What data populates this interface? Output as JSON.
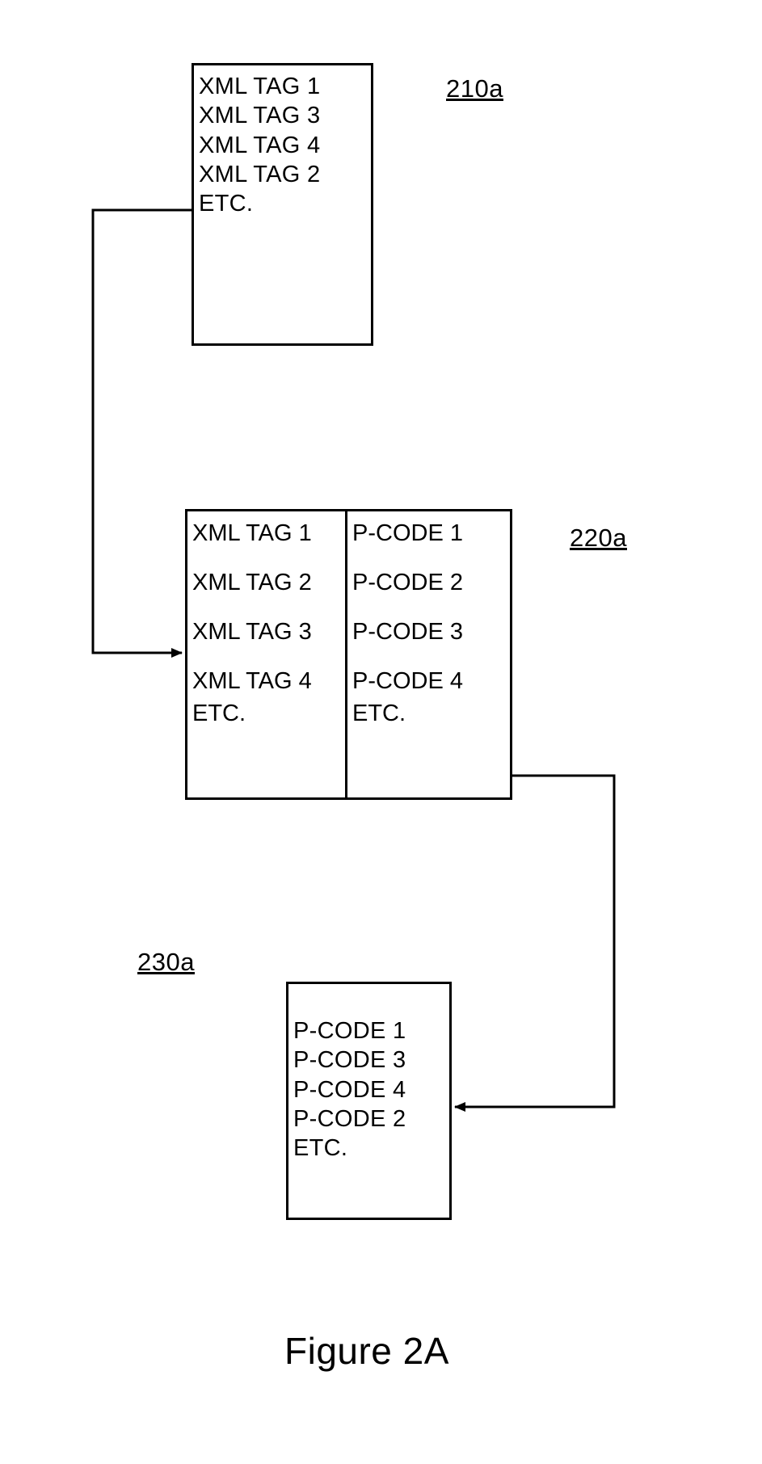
{
  "figure_label": "Figure 2A",
  "labels": {
    "box_210a": "210a",
    "box_220a": "220a",
    "box_230a": "230a"
  },
  "box_210a": {
    "lines": [
      "XML TAG 1",
      "XML TAG 3",
      "XML TAG 4",
      "XML TAG 2",
      "ETC."
    ]
  },
  "box_220a": {
    "left_col": [
      "XML TAG 1",
      "XML TAG 2",
      "XML TAG 3",
      "XML TAG 4",
      "ETC."
    ],
    "right_col": [
      "P-CODE 1",
      "P-CODE 2",
      "P-CODE 3",
      "P-CODE 4",
      "ETC."
    ]
  },
  "box_230a": {
    "lines": [
      "P-CODE 1",
      "P-CODE 3",
      "P-CODE 4",
      "P-CODE 2",
      "ETC."
    ]
  }
}
